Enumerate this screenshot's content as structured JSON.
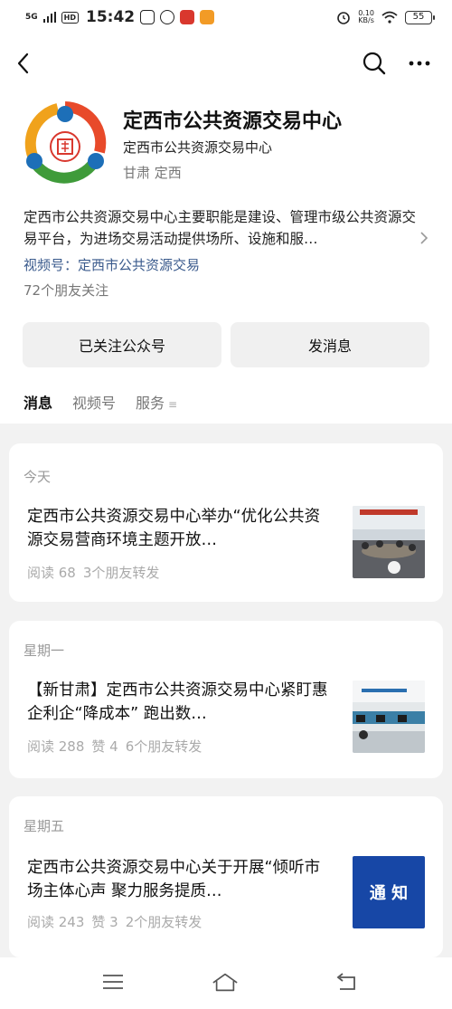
{
  "status_bar": {
    "signal_label": "5G",
    "hd_label": "HD",
    "time": "15:42",
    "net_speed_value": "0.10",
    "net_speed_unit": "KB/s",
    "battery": "55"
  },
  "account": {
    "name": "定西市公共资源交易中心",
    "subtitle": "定西市公共资源交易中心",
    "location": "甘肃 定西",
    "description": "定西市公共资源交易中心主要职能是建设、管理市级公共资源交易平台，为进场交易活动提供场所、设施和服…",
    "channel": "视频号：定西市公共资源交易",
    "followers": "72个朋友关注"
  },
  "actions": {
    "follow_label": "已关注公众号",
    "message_label": "发消息"
  },
  "tabs": [
    {
      "label": "消息"
    },
    {
      "label": "视频号"
    },
    {
      "label": "服务"
    }
  ],
  "feed": [
    {
      "day": "今天",
      "title": "定西市公共资源交易中心举办“优化公共资源交易营商环境主题开放…",
      "reads": "阅读 68",
      "likes": "",
      "shares": "3个朋友转发"
    },
    {
      "day": "星期一",
      "title": "【新甘肃】定西市公共资源交易中心紧盯惠企利企“降成本” 跑出数…",
      "reads": "阅读 288",
      "likes": "赞 4",
      "shares": "6个朋友转发"
    },
    {
      "day": "星期五",
      "title": "定西市公共资源交易中心关于开展“倾听市场主体心声 聚力服务提质…",
      "reads": "阅读 243",
      "likes": "赞 3",
      "shares": "2个朋友转发",
      "thumb_text": "通 知"
    }
  ],
  "colors": {
    "accent_link": "#3a5a8c",
    "button_bg": "#f0f0f0",
    "feed_bg": "#f2f2f2",
    "notice_blue": "#1747a6"
  },
  "icons": {
    "back": "back-arrow-icon",
    "search": "search-icon",
    "more": "more-dots-icon",
    "menu": "menu-icon",
    "home": "home-icon",
    "return": "return-icon"
  }
}
